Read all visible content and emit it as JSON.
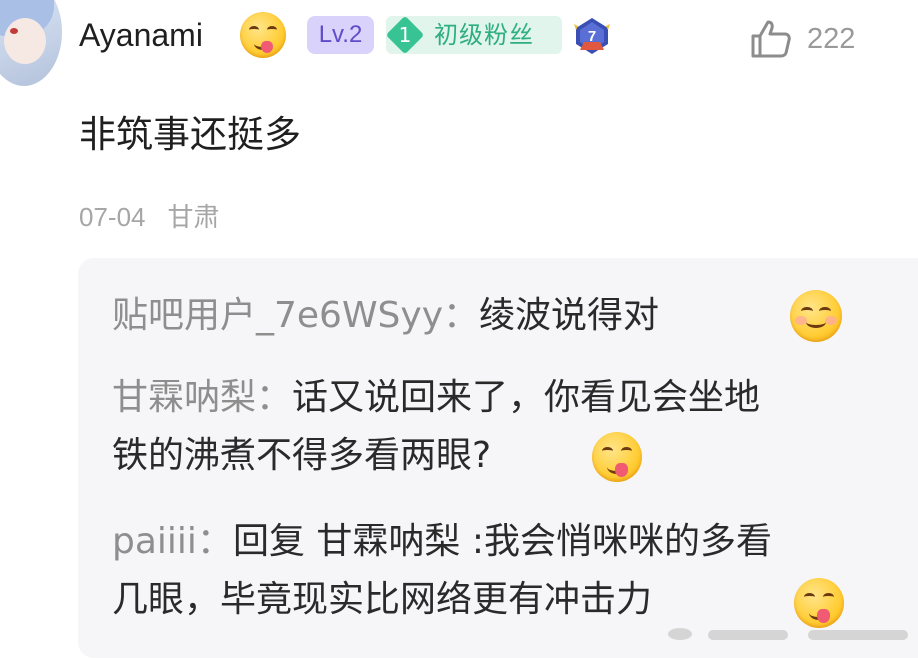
{
  "comment": {
    "username": "Ayanami",
    "level_badge": "Lv.2",
    "fan_badge": {
      "level": "1",
      "label": "初级粉丝"
    },
    "medal_number": "7",
    "like_count": "222",
    "text": "非筑事还挺多",
    "date": "07-04",
    "location": "甘肃"
  },
  "replies": [
    {
      "name": "贴吧用户_7e6WSyy",
      "separator": "：",
      "lines": [
        "绫波说得对"
      ],
      "emoji": "shy-smile-emoji"
    },
    {
      "name": "甘霖呐梨",
      "separator": "：",
      "lines": [
        "话又说回来了，你看见会坐地",
        "铁的沸煮不得多看两眼?"
      ],
      "emoji": "tongue-out-emoji"
    },
    {
      "name": "paiiii",
      "separator": "：",
      "lines": [
        "回复 甘霖呐梨 :我会悄咪咪的多看",
        "几眼，毕竟现实比网络更有冲击力"
      ],
      "emoji": "tongue-out-emoji"
    }
  ],
  "colors": {
    "level_badge_bg": "#d9d3fb",
    "level_badge_text": "#5e4cc9",
    "fan_badge_bg": "#e1f5ec",
    "fan_badge_accent": "#37c394",
    "reply_panel_bg": "#f6f6f8",
    "muted_text": "#a6a6a6"
  }
}
